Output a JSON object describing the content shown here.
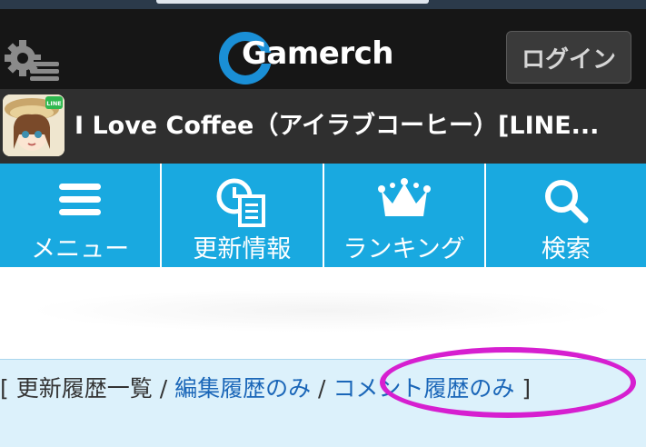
{
  "header": {
    "logo_text": "Gamerch",
    "login_label": "ログイン"
  },
  "page": {
    "title": "I Love Coffee（アイラブコーヒー）[LINE..."
  },
  "nav": {
    "items": [
      {
        "label": "メニュー",
        "icon": "menu-icon"
      },
      {
        "label": "更新情報",
        "icon": "update-icon"
      },
      {
        "label": "ランキング",
        "icon": "crown-icon"
      },
      {
        "label": "検索",
        "icon": "search-icon"
      }
    ]
  },
  "history": {
    "open_bracket": "[",
    "all_label": "更新履歴一覧",
    "sep1": " / ",
    "edit_label": "編集履歴のみ",
    "sep2": " / ",
    "comment_label": "コメント履歴のみ",
    "close_bracket": "]"
  },
  "colors": {
    "header_bg": "#161616",
    "nav_bg": "#19a9e0",
    "logo_accent": "#1a8fd6",
    "link": "#1a66b8",
    "highlight_ring": "#d61fd0",
    "history_bg": "#dcf1fb"
  }
}
